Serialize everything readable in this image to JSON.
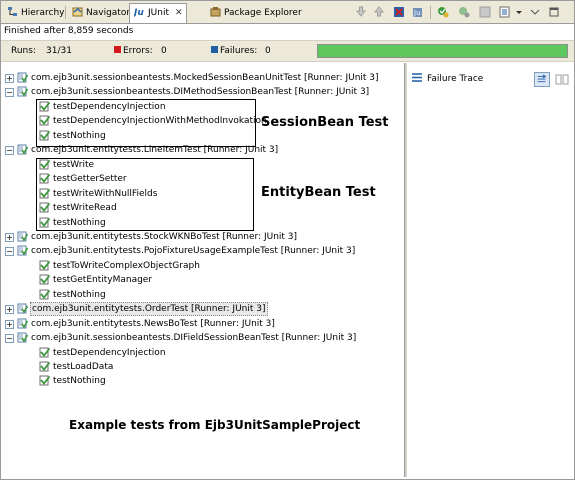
{
  "tabs": [
    {
      "label": "Hierarchy",
      "icon": "hierarchy-icon"
    },
    {
      "label": "Navigator",
      "icon": "navigator-icon"
    },
    {
      "label": "JUnit",
      "icon": "junit-icon",
      "active": true
    },
    {
      "label": "Package Explorer",
      "icon": "package-explorer-icon"
    }
  ],
  "toolbar_icons": [
    "next-failure-icon",
    "previous-failure-icon",
    "stop-icon",
    "rerun-icon",
    "rerun-failed-icon",
    "scroll-lock-icon",
    "history-icon",
    "view-menu-icon",
    "minimize-icon",
    "maximize-icon"
  ],
  "status": {
    "finished": "Finished after 8,859 seconds"
  },
  "counters": {
    "runs_label": "Runs:",
    "runs_value": "31/31",
    "errors_label": "Errors:",
    "errors_value": "0",
    "failures_label": "Failures:",
    "failures_value": "0"
  },
  "progress": {
    "fraction": 1.0,
    "color": "#5ec75e"
  },
  "tree": [
    {
      "type": "suite",
      "expanded": false,
      "label": "com.ejb3unit.sessionbeantests.MockedSessionBeanUnitTest [Runner: JUnit 3]"
    },
    {
      "type": "suite",
      "expanded": true,
      "label": "com.ejb3unit.sessionbeantests.DIMethodSessionBeanTest [Runner: JUnit 3]"
    },
    {
      "type": "test",
      "label": "testDependencyInjection"
    },
    {
      "type": "test",
      "label": "testDependencyInjectionWithMethodInvokation"
    },
    {
      "type": "test",
      "label": "testNothing"
    },
    {
      "type": "suite",
      "expanded": true,
      "label": "com.ejb3unit.entitytests.LineItemTest [Runner: JUnit 3]"
    },
    {
      "type": "test",
      "label": "testWrite"
    },
    {
      "type": "test",
      "label": "testGetterSetter"
    },
    {
      "type": "test",
      "label": "testWriteWithNullFields"
    },
    {
      "type": "test",
      "label": "testWriteRead"
    },
    {
      "type": "test",
      "label": "testNothing"
    },
    {
      "type": "suite",
      "expanded": false,
      "label": "com.ejb3unit.entitytests.StockWKNBoTest [Runner: JUnit 3]"
    },
    {
      "type": "suite",
      "expanded": true,
      "label": "com.ejb3unit.entitytests.PojoFixtureUsageExampleTest [Runner: JUnit 3]"
    },
    {
      "type": "test",
      "label": "testToWriteComplexObjectGraph"
    },
    {
      "type": "test",
      "label": "testGetEntityManager"
    },
    {
      "type": "test",
      "label": "testNothing"
    },
    {
      "type": "suite",
      "expanded": false,
      "selected": true,
      "label": "com.ejb3unit.entitytests.OrderTest [Runner: JUnit 3]"
    },
    {
      "type": "suite",
      "expanded": false,
      "label": "com.ejb3unit.entitytests.NewsBoTest [Runner: JUnit 3]"
    },
    {
      "type": "suite",
      "expanded": true,
      "label": "com.ejb3unit.sessionbeantests.DIFieldSessionBeanTest [Runner: JUnit 3]"
    },
    {
      "type": "test",
      "label": "testDependencyInjection"
    },
    {
      "type": "test",
      "label": "testLoadData"
    },
    {
      "type": "test",
      "label": "testNothing"
    }
  ],
  "annotations": {
    "session_bean": "SessionBean Test",
    "entity_bean": "EntityBean Test",
    "footer": "Example tests from Ejb3UnitSampleProject"
  },
  "trace": {
    "title": "Failure Trace",
    "icon": "failure-trace-icon",
    "buttons": [
      "filter-stack-icon",
      "compare-results-icon"
    ]
  },
  "colors": {
    "pass_green": "#3c9a3c",
    "error_red": "#d21b1b",
    "failure_blue": "#1f5fa6"
  }
}
